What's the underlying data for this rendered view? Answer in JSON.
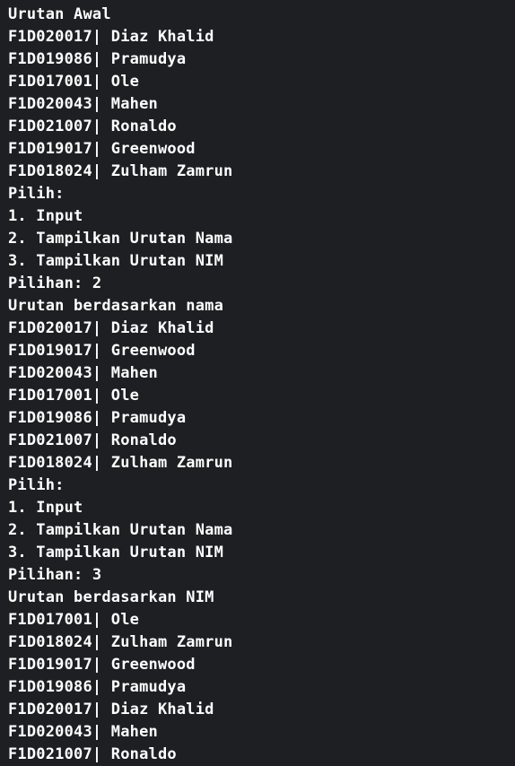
{
  "terminal": {
    "lines": [
      "Urutan Awal",
      "F1D020017| Diaz Khalid",
      "F1D019086| Pramudya",
      "F1D017001| Ole",
      "F1D020043| Mahen",
      "F1D021007| Ronaldo",
      "F1D019017| Greenwood",
      "F1D018024| Zulham Zamrun",
      "Pilih:",
      "1. Input",
      "2. Tampilkan Urutan Nama",
      "3. Tampilkan Urutan NIM",
      "Pilihan: 2",
      "Urutan berdasarkan nama",
      "F1D020017| Diaz Khalid",
      "F1D019017| Greenwood",
      "F1D020043| Mahen",
      "F1D017001| Ole",
      "F1D019086| Pramudya",
      "F1D021007| Ronaldo",
      "F1D018024| Zulham Zamrun",
      "Pilih:",
      "1. Input",
      "2. Tampilkan Urutan Nama",
      "3. Tampilkan Urutan NIM",
      "Pilihan: 3",
      "Urutan berdasarkan NIM",
      "F1D017001| Ole",
      "F1D018024| Zulham Zamrun",
      "F1D019017| Greenwood",
      "F1D019086| Pramudya",
      "F1D020017| Diaz Khalid",
      "F1D020043| Mahen",
      "F1D021007| Ronaldo"
    ]
  }
}
